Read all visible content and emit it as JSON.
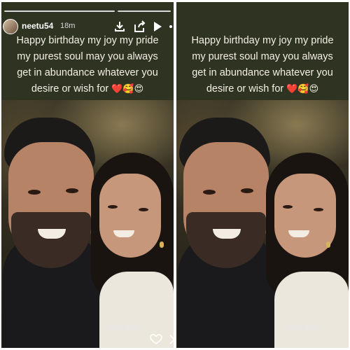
{
  "story": {
    "username": "neetu54",
    "time_ago": "18m",
    "caption_lines": [
      "Happy birthday my joy my pride",
      "my purest soul  may you always",
      "get in abundance whatever you",
      "desire or wish for"
    ],
    "caption_emojis": "❤️🥰😍",
    "watermark": "@arks"
  },
  "icons": {
    "download": "download-icon",
    "share": "share-icon",
    "play": "play-icon",
    "more": "more-icon",
    "heart": "heart-icon",
    "send": "send-icon"
  },
  "colors": {
    "caption_text": "#f4f0e6",
    "story_background": "#2e3322"
  }
}
